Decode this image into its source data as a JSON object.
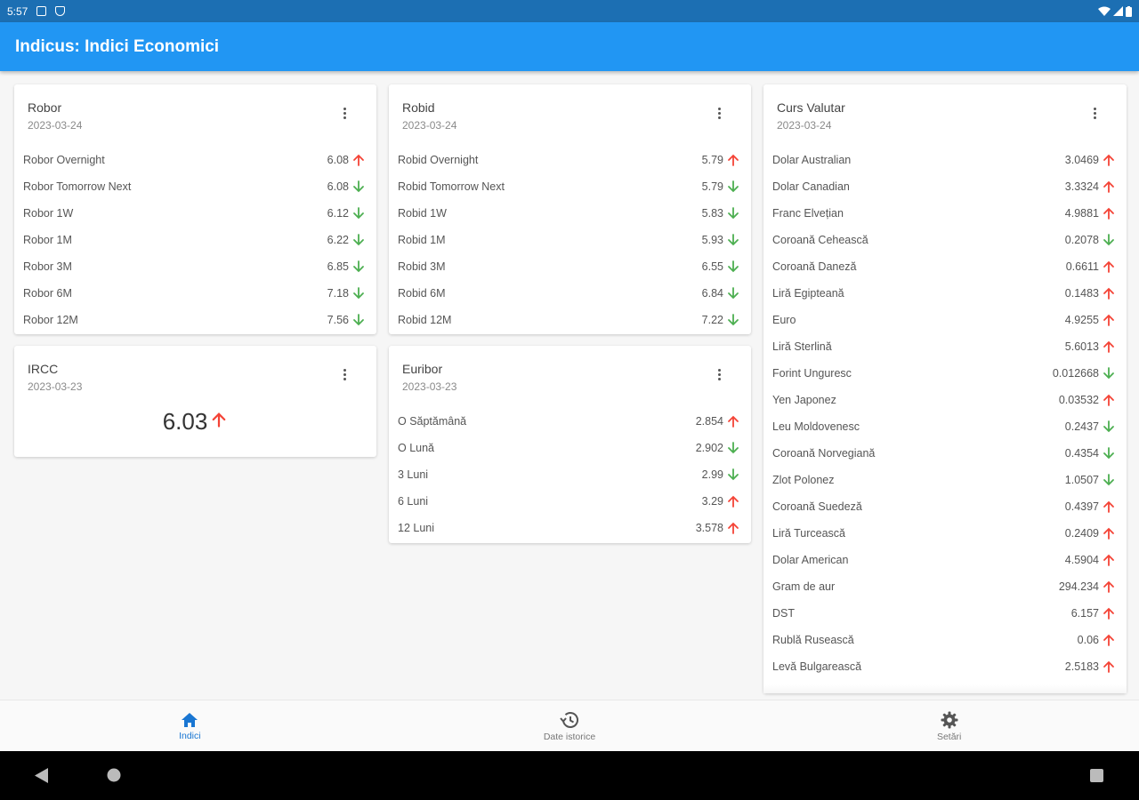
{
  "status_bar": {
    "time": "5:57"
  },
  "app_bar": {
    "title": "Indicus: Indici Economici"
  },
  "colors": {
    "up": "#f44336",
    "down": "#4caf50",
    "primary": "#2196f3"
  },
  "cards": {
    "robor": {
      "title": "Robor",
      "date": "2023-03-24",
      "rows": [
        {
          "label": "Robor Overnight",
          "value": "6.08",
          "trend": "up"
        },
        {
          "label": "Robor Tomorrow Next",
          "value": "6.08",
          "trend": "down"
        },
        {
          "label": "Robor 1W",
          "value": "6.12",
          "trend": "down"
        },
        {
          "label": "Robor 1M",
          "value": "6.22",
          "trend": "down"
        },
        {
          "label": "Robor 3M",
          "value": "6.85",
          "trend": "down"
        },
        {
          "label": "Robor 6M",
          "value": "7.18",
          "trend": "down"
        },
        {
          "label": "Robor 12M",
          "value": "7.56",
          "trend": "down"
        }
      ]
    },
    "ircc": {
      "title": "IRCC",
      "date": "2023-03-23",
      "value": "6.03",
      "trend": "up"
    },
    "robid": {
      "title": "Robid",
      "date": "2023-03-24",
      "rows": [
        {
          "label": "Robid Overnight",
          "value": "5.79",
          "trend": "up"
        },
        {
          "label": "Robid Tomorrow Next",
          "value": "5.79",
          "trend": "down"
        },
        {
          "label": "Robid 1W",
          "value": "5.83",
          "trend": "down"
        },
        {
          "label": "Robid 1M",
          "value": "5.93",
          "trend": "down"
        },
        {
          "label": "Robid 3M",
          "value": "6.55",
          "trend": "down"
        },
        {
          "label": "Robid 6M",
          "value": "6.84",
          "trend": "down"
        },
        {
          "label": "Robid 12M",
          "value": "7.22",
          "trend": "down"
        }
      ]
    },
    "euribor": {
      "title": "Euribor",
      "date": "2023-03-23",
      "rows": [
        {
          "label": "O Săptămână",
          "value": "2.854",
          "trend": "up"
        },
        {
          "label": "O Lună",
          "value": "2.902",
          "trend": "down"
        },
        {
          "label": "3 Luni",
          "value": "2.99",
          "trend": "down"
        },
        {
          "label": "6 Luni",
          "value": "3.29",
          "trend": "up"
        },
        {
          "label": "12 Luni",
          "value": "3.578",
          "trend": "up"
        }
      ]
    },
    "curs": {
      "title": "Curs Valutar",
      "date": "2023-03-24",
      "rows": [
        {
          "label": "Dolar Australian",
          "value": "3.0469",
          "trend": "up"
        },
        {
          "label": "Dolar Canadian",
          "value": "3.3324",
          "trend": "up"
        },
        {
          "label": "Franc Elvețian",
          "value": "4.9881",
          "trend": "up"
        },
        {
          "label": "Coroană Cehească",
          "value": "0.2078",
          "trend": "down"
        },
        {
          "label": "Coroană Daneză",
          "value": "0.6611",
          "trend": "up"
        },
        {
          "label": "Liră Egipteană",
          "value": "0.1483",
          "trend": "up"
        },
        {
          "label": "Euro",
          "value": "4.9255",
          "trend": "up"
        },
        {
          "label": "Liră Sterlină",
          "value": "5.6013",
          "trend": "up"
        },
        {
          "label": "Forint Unguresc",
          "value": "0.012668",
          "trend": "down"
        },
        {
          "label": "Yen Japonez",
          "value": "0.03532",
          "trend": "up"
        },
        {
          "label": "Leu Moldovenesc",
          "value": "0.2437",
          "trend": "down"
        },
        {
          "label": "Coroană Norvegiană",
          "value": "0.4354",
          "trend": "down"
        },
        {
          "label": "Zlot Polonez",
          "value": "1.0507",
          "trend": "down"
        },
        {
          "label": "Coroană Suedeză",
          "value": "0.4397",
          "trend": "up"
        },
        {
          "label": "Liră Turcească",
          "value": "0.2409",
          "trend": "up"
        },
        {
          "label": "Dolar American",
          "value": "4.5904",
          "trend": "up"
        },
        {
          "label": "Gram de aur",
          "value": "294.234",
          "trend": "up"
        },
        {
          "label": "DST",
          "value": "6.157",
          "trend": "up"
        },
        {
          "label": "Rublă Rusească",
          "value": "0.06",
          "trend": "up"
        },
        {
          "label": "Levă Bulgarească",
          "value": "2.5183",
          "trend": "up"
        }
      ]
    }
  },
  "bottom_nav": [
    {
      "label": "Indici",
      "icon": "home-icon",
      "active": true
    },
    {
      "label": "Date istorice",
      "icon": "history-icon",
      "active": false
    },
    {
      "label": "Setări",
      "icon": "gear-icon",
      "active": false
    }
  ]
}
